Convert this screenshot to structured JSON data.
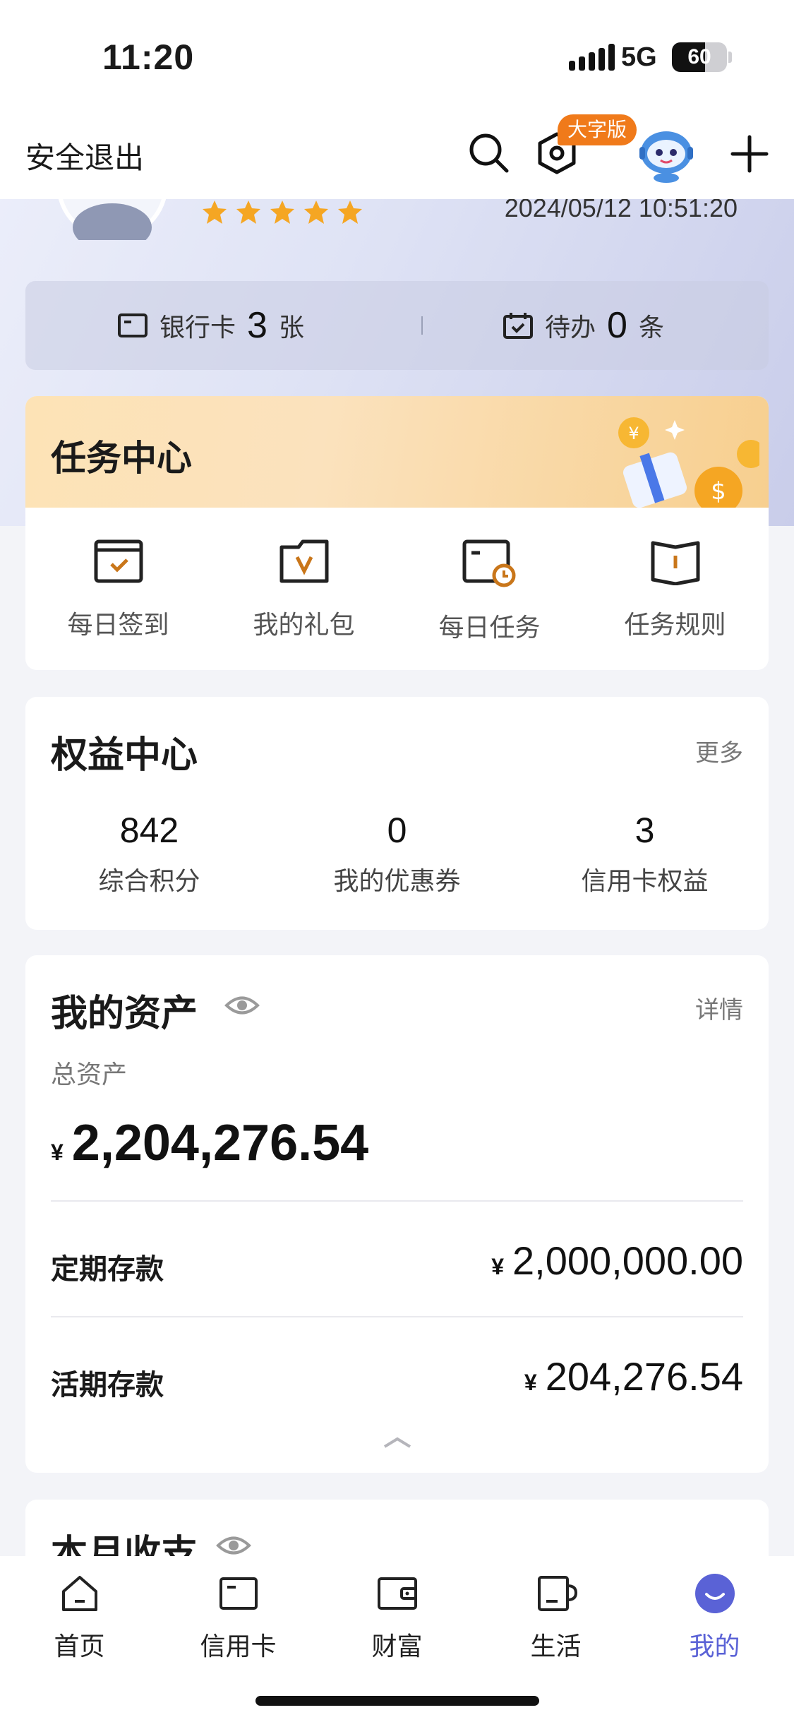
{
  "status_bar": {
    "time": "11:20",
    "network": "5G",
    "battery": "60",
    "battery_level": 0.6
  },
  "header": {
    "logout_label": "安全退出",
    "big_font_badge": "大字版",
    "icons": [
      "search-icon",
      "settings-hex-icon",
      "assistant-robot-icon",
      "plus-icon"
    ]
  },
  "profile": {
    "star_count": 5,
    "login_time": "2024/05/12 10:51:20"
  },
  "counters": {
    "bank_card": {
      "label": "银行卡",
      "count": "3",
      "unit": "张"
    },
    "todo": {
      "label": "待办",
      "count": "0",
      "unit": "条"
    }
  },
  "task_center": {
    "title": "任务中心",
    "items": [
      {
        "label": "每日签到",
        "icon": "sign-in-card-icon"
      },
      {
        "label": "我的礼包",
        "icon": "gift-folder-icon"
      },
      {
        "label": "每日任务",
        "icon": "task-clock-icon"
      },
      {
        "label": "任务规则",
        "icon": "rules-book-icon"
      }
    ]
  },
  "rights_center": {
    "title": "权益中心",
    "more_label": "更多",
    "items": [
      {
        "value": "842",
        "label": "综合积分"
      },
      {
        "value": "0",
        "label": "我的优惠券"
      },
      {
        "value": "3",
        "label": "信用卡权益"
      }
    ]
  },
  "assets": {
    "title": "我的资产",
    "detail_label": "详情",
    "total_label": "总资产",
    "currency": "¥",
    "total": "2,204,276.54",
    "rows": [
      {
        "name": "定期存款",
        "amount": "2,000,000.00"
      },
      {
        "name": "活期存款",
        "amount": "204,276.54"
      }
    ]
  },
  "monthly": {
    "title": "本月收支"
  },
  "tabbar": {
    "active": "我的",
    "tabs": [
      {
        "label": "首页",
        "icon": "home-icon"
      },
      {
        "label": "信用卡",
        "icon": "credit-card-icon"
      },
      {
        "label": "财富",
        "icon": "wallet-icon"
      },
      {
        "label": "生活",
        "icon": "coffee-cup-icon"
      },
      {
        "label": "我的",
        "icon": "me-smile-icon"
      }
    ]
  },
  "colors": {
    "accent": "#5a62d6",
    "badge": "#f07a1a",
    "task_icon": "#c9761a",
    "star": "#f5a623"
  }
}
